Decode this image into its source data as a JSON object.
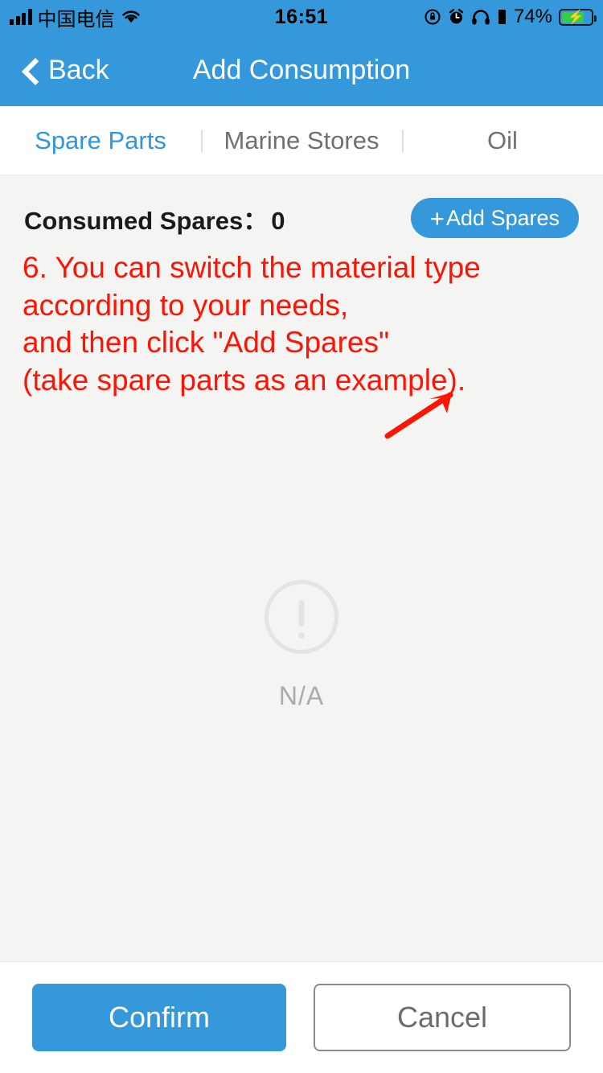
{
  "status_bar": {
    "carrier": "中国电信",
    "time": "16:51",
    "battery_percent": "74%",
    "icons": [
      "signal-bars-icon",
      "wifi-icon",
      "rotation-lock-icon",
      "alarm-clock-icon",
      "headphones-icon",
      "device-battery-icon",
      "charging-battery-icon"
    ]
  },
  "nav": {
    "back_label": "Back",
    "title": "Add Consumption",
    "bar_color": "#3498db"
  },
  "tabs": [
    {
      "label": "Spare Parts",
      "active": true
    },
    {
      "label": "Marine Stores",
      "active": false
    },
    {
      "label": "Oil",
      "active": false
    }
  ],
  "content": {
    "consumed_label": "Consumed Spares：",
    "consumed_count": "0",
    "add_button_label": "Add Spares",
    "add_button_plus": "+",
    "annotation": "6. You can switch the material type\naccording to your needs,\nand then click \"Add Spares\"\n(take spare parts as an example).",
    "annotation_color": "#fc1505",
    "empty_label": "N/A"
  },
  "footer": {
    "confirm_label": "Confirm",
    "cancel_label": "Cancel"
  }
}
